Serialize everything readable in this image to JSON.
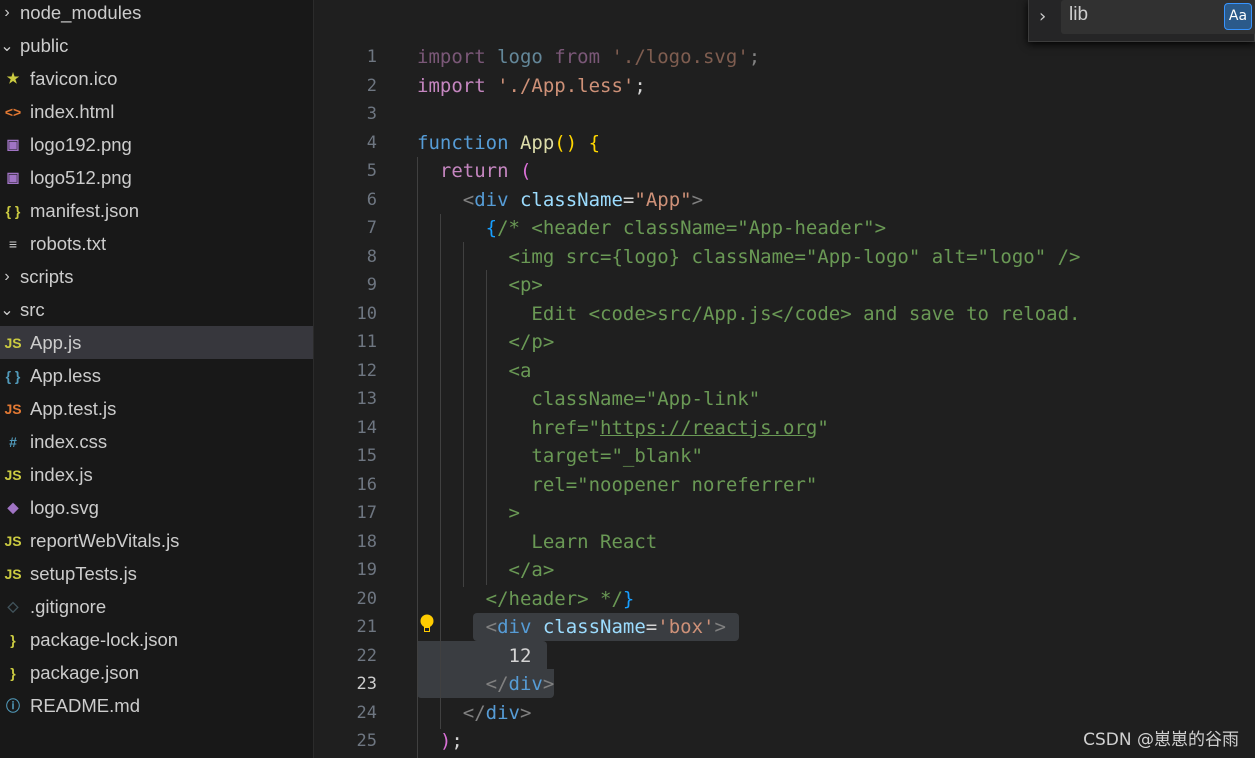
{
  "explorer": [
    {
      "label": "node_modules",
      "type": "folder",
      "open": false,
      "icon": "chevron-right-icon"
    },
    {
      "label": "public",
      "type": "folder",
      "open": true,
      "icon": "chevron-down-icon"
    },
    {
      "label": "favicon.ico",
      "icon": "star-icon",
      "glyph": "★",
      "color": "#cbcb41"
    },
    {
      "label": "index.html",
      "icon": "html-icon",
      "glyph": "<>",
      "color": "#e37933"
    },
    {
      "label": "logo192.png",
      "icon": "image-icon",
      "glyph": "▣",
      "color": "#a074c4"
    },
    {
      "label": "logo512.png",
      "icon": "image-icon",
      "glyph": "▣",
      "color": "#a074c4"
    },
    {
      "label": "manifest.json",
      "icon": "json-icon",
      "glyph": "{ }",
      "color": "#cbcb41"
    },
    {
      "label": "robots.txt",
      "icon": "text-file-icon",
      "glyph": "≡",
      "color": "#cccccc"
    },
    {
      "label": "scripts",
      "type": "folder",
      "open": false,
      "icon": "chevron-right-icon"
    },
    {
      "label": "src",
      "type": "folder",
      "open": true,
      "icon": "chevron-down-icon"
    },
    {
      "label": "App.js",
      "icon": "js-icon",
      "glyph": "JS",
      "color": "#cbcb41",
      "selected": true
    },
    {
      "label": "App.less",
      "icon": "less-icon",
      "glyph": "{ }",
      "color": "#519aba"
    },
    {
      "label": "App.test.js",
      "icon": "js-test-icon",
      "glyph": "JS",
      "color": "#e37933"
    },
    {
      "label": "index.css",
      "icon": "css-icon",
      "glyph": "#",
      "color": "#519aba"
    },
    {
      "label": "index.js",
      "icon": "js-icon",
      "glyph": "JS",
      "color": "#cbcb41"
    },
    {
      "label": "logo.svg",
      "icon": "svg-icon",
      "glyph": "◆",
      "color": "#a074c4"
    },
    {
      "label": "reportWebVitals.js",
      "icon": "js-icon",
      "glyph": "JS",
      "color": "#cbcb41"
    },
    {
      "label": "setupTests.js",
      "icon": "js-icon",
      "glyph": "JS",
      "color": "#cbcb41"
    },
    {
      "label": ".gitignore",
      "icon": "git-icon",
      "glyph": "◇",
      "color": "#41535b"
    },
    {
      "label": "package-lock.json",
      "icon": "json-icon",
      "glyph": "}",
      "color": "#cbcb41"
    },
    {
      "label": "package.json",
      "icon": "json-icon",
      "glyph": "}",
      "color": "#cbcb41"
    },
    {
      "label": "README.md",
      "icon": "info-icon",
      "glyph": "ⓘ",
      "color": "#519aba"
    }
  ],
  "find": {
    "value": "lib",
    "match_case_label": "Aa"
  },
  "current_line": 23,
  "code": [
    [
      [
        "import ",
        "kw dim"
      ],
      [
        "logo ",
        "at dim"
      ],
      [
        "from ",
        "kw dim"
      ],
      [
        "'./logo.svg'",
        "str dim"
      ],
      [
        ";",
        "tx dim"
      ]
    ],
    [
      [
        "import ",
        "kw"
      ],
      [
        "'./App.less'",
        "str"
      ],
      [
        ";",
        "tx"
      ]
    ],
    [],
    [
      [
        "function ",
        "kwb"
      ],
      [
        "App",
        "fn"
      ],
      [
        "()",
        "b1"
      ],
      [
        " ",
        "tx"
      ],
      [
        "{",
        "b1"
      ]
    ],
    [
      [
        "  return ",
        "kw"
      ],
      [
        "(",
        "b2"
      ]
    ],
    [
      [
        "    <",
        "pn"
      ],
      [
        "div ",
        "tag"
      ],
      [
        "className",
        "at"
      ],
      [
        "=",
        "tx"
      ],
      [
        "\"App\"",
        "str"
      ],
      [
        ">",
        "pn"
      ]
    ],
    [
      [
        "      {",
        "b3"
      ],
      [
        "/* <header className=\"App-header\">",
        "cm"
      ]
    ],
    [
      [
        "        <img src={logo} className=\"App-logo\" alt=\"logo\" />",
        "cm"
      ]
    ],
    [
      [
        "        <p>",
        "cm"
      ]
    ],
    [
      [
        "          Edit <code>src/App.js</code> and save to reload.",
        "cm"
      ]
    ],
    [
      [
        "        </p>",
        "cm"
      ]
    ],
    [
      [
        "        <a",
        "cm"
      ]
    ],
    [
      [
        "          className=\"App-link\"",
        "cm"
      ]
    ],
    [
      [
        "          href=\"",
        "cm"
      ],
      [
        "https://reactjs.org",
        "cm ul"
      ],
      [
        "\"",
        "cm"
      ]
    ],
    [
      [
        "          target=\"_blank\"",
        "cm"
      ]
    ],
    [
      [
        "          rel=\"noopener noreferrer\"",
        "cm"
      ]
    ],
    [
      [
        "        >",
        "cm"
      ]
    ],
    [
      [
        "          Learn React",
        "cm"
      ]
    ],
    [
      [
        "        </a>",
        "cm"
      ]
    ],
    [
      [
        "      </header> */",
        "cm"
      ],
      [
        "}",
        "b3"
      ]
    ],
    [
      [
        "      <",
        "pn"
      ],
      [
        "div ",
        "tag"
      ],
      [
        "className",
        "at"
      ],
      [
        "=",
        "tx"
      ],
      [
        "'box'",
        "str"
      ],
      [
        ">",
        "pn"
      ]
    ],
    [
      [
        "        12",
        "tx"
      ]
    ],
    [
      [
        "      </",
        "pn"
      ],
      [
        "div",
        "tag"
      ],
      [
        ">",
        "pn"
      ]
    ],
    [
      [
        "    </",
        "pn"
      ],
      [
        "div",
        "tag"
      ],
      [
        ">",
        "pn"
      ]
    ],
    [
      [
        "  ",
        "tx"
      ],
      [
        ")",
        "b2"
      ],
      [
        ";",
        "tx"
      ]
    ]
  ],
  "watermark": "CSDN @崽崽的谷雨"
}
